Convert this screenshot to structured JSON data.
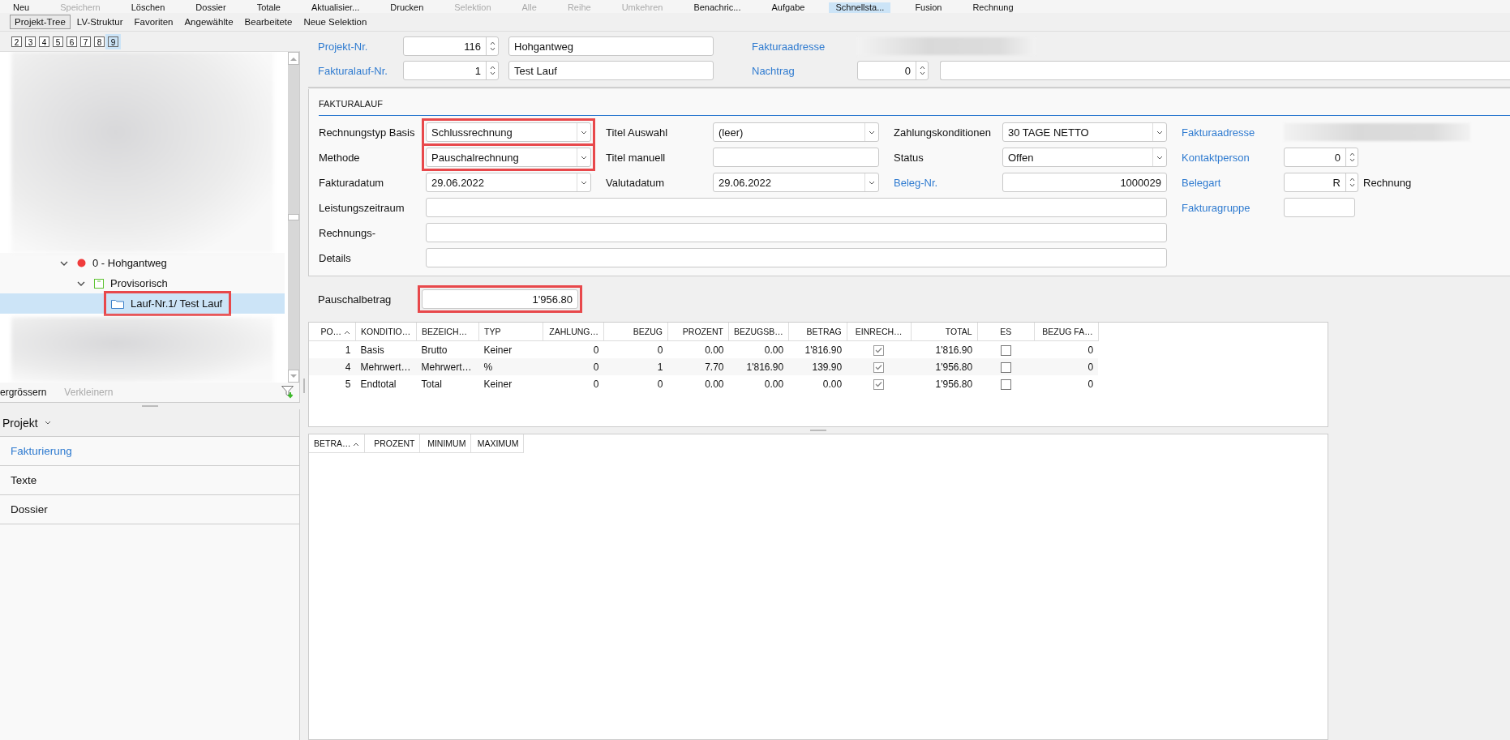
{
  "toolbar": [
    {
      "label": "Neu",
      "disabled": false,
      "selected": false
    },
    {
      "label": "Speichern",
      "disabled": true,
      "selected": false
    },
    {
      "label": "Löschen",
      "disabled": false,
      "selected": false
    },
    {
      "label": "Dossier",
      "disabled": false,
      "selected": false
    },
    {
      "label": "Totale",
      "disabled": false,
      "selected": false
    },
    {
      "label": "Aktualisier...",
      "disabled": false,
      "selected": false
    },
    {
      "label": "Drucken",
      "disabled": false,
      "selected": false
    },
    {
      "label": "Selektion",
      "disabled": true,
      "selected": false
    },
    {
      "label": "Alle",
      "disabled": true,
      "selected": false
    },
    {
      "label": "Reihe",
      "disabled": true,
      "selected": false
    },
    {
      "label": "Umkehren",
      "disabled": true,
      "selected": false
    },
    {
      "label": "Benachric...",
      "disabled": false,
      "selected": false
    },
    {
      "label": "Aufgabe",
      "disabled": false,
      "selected": false
    },
    {
      "label": "Schnellsta...",
      "disabled": false,
      "selected": true
    },
    {
      "label": "Fusion",
      "disabled": false,
      "selected": false
    },
    {
      "label": "Rechnung",
      "disabled": false,
      "selected": false
    }
  ],
  "tabs": [
    {
      "label": "Projekt-Tree",
      "selected": true
    },
    {
      "label": "LV-Struktur",
      "selected": false
    },
    {
      "label": "Favoriten",
      "selected": false
    },
    {
      "label": "Angewählte",
      "selected": false
    },
    {
      "label": "Bearbeitete",
      "selected": false
    },
    {
      "label": "Neue Selektion",
      "selected": false
    }
  ],
  "levels": [
    {
      "label": "2",
      "selected": false
    },
    {
      "label": "3",
      "selected": false
    },
    {
      "label": "4",
      "selected": false
    },
    {
      "label": "5",
      "selected": false
    },
    {
      "label": "6",
      "selected": false
    },
    {
      "label": "7",
      "selected": false
    },
    {
      "label": "8",
      "selected": false
    },
    {
      "label": "9",
      "selected": true
    }
  ],
  "tree": [
    {
      "label": "0 - Hohgantweg",
      "kind": "status",
      "expanded": true,
      "selected": false,
      "highlighted": false,
      "children": [
        {
          "label": "Provisorisch",
          "kind": "draft",
          "expanded": true,
          "selected": false,
          "highlighted": false,
          "children": [
            {
              "label": "Lauf-Nr.1/ Test Lauf",
              "kind": "folder",
              "selected": true,
              "highlighted": true
            }
          ]
        }
      ]
    }
  ],
  "tree_footer": [
    {
      "label": "ergrössern",
      "disabled": false
    },
    {
      "label": "Verkleinern",
      "disabled": true
    }
  ],
  "nav": {
    "header": "Projekt",
    "items": [
      {
        "label": "Fakturierung",
        "selected": true
      },
      {
        "label": "Texte",
        "selected": false
      },
      {
        "label": "Dossier",
        "selected": false
      }
    ]
  },
  "header": {
    "rows": [
      {
        "label": "Projekt-Nr.",
        "link": true,
        "number": "116",
        "text": "Hohgantweg",
        "right": {
          "label": "Fakturaadresse",
          "link": true,
          "kind": "blurred"
        }
      },
      {
        "label": "Fakturalauf-Nr.",
        "link": true,
        "number": "1",
        "text": "Test Lauf",
        "right": {
          "label": "Nachtrag",
          "link": true,
          "kind": "spinner",
          "value": "0"
        }
      }
    ]
  },
  "fakturalauf": {
    "title": "FAKTURALAUF",
    "rows": [
      [
        {
          "label": "Rechnungstyp Basis",
          "link": false,
          "kind": "dropdown",
          "value": "Schlussrechnung",
          "highlighted": true
        },
        {
          "label": "Titel Auswahl",
          "link": false,
          "kind": "dropdown",
          "value": "(leer)",
          "highlighted": false
        },
        {
          "label": "Zahlungskonditionen",
          "link": false,
          "kind": "dropdown",
          "value": "30 TAGE NETTO",
          "highlighted": false
        },
        {
          "label": "Fakturaadresse",
          "link": true,
          "kind": "blurred",
          "highlighted": false
        }
      ],
      [
        {
          "label": "Methode",
          "link": false,
          "kind": "dropdown",
          "value": "Pauschalrechnung",
          "highlighted": true
        },
        {
          "label": "Titel manuell",
          "link": false,
          "kind": "text",
          "highlighted": false
        },
        {
          "label": "Status",
          "link": false,
          "kind": "dropdown",
          "value": "Offen",
          "highlighted": false
        },
        {
          "label": "Kontaktperson",
          "link": true,
          "kind": "spinner",
          "value": "0",
          "highlighted": false
        }
      ],
      [
        {
          "label": "Fakturadatum",
          "link": false,
          "kind": "dropdown",
          "value": "29.06.2022",
          "highlighted": false
        },
        {
          "label": "Valutadatum",
          "link": false,
          "kind": "dropdown",
          "value": "29.06.2022",
          "highlighted": false
        },
        {
          "label": "Beleg-Nr.",
          "link": true,
          "kind": "number",
          "value": "1000029",
          "highlighted": false
        },
        {
          "label": "Belegart",
          "link": true,
          "kind": "spinner",
          "value": "R",
          "suffix": "Rechnung",
          "highlighted": false
        }
      ],
      [
        {
          "label": "Leistungszeitraum",
          "link": false,
          "kind": "wide",
          "highlighted": false
        },
        "",
        "",
        {
          "label": "Fakturagruppe",
          "link": true,
          "kind": "small",
          "highlighted": false
        }
      ],
      [
        {
          "label": "Rechnungs-",
          "link": false,
          "kind": "wide",
          "highlighted": false
        }
      ],
      [
        {
          "label": "Details",
          "link": false,
          "kind": "wide",
          "highlighted": false
        }
      ]
    ]
  },
  "pauschal": {
    "label": "Pauschalbetrag",
    "value": "1'956.80",
    "highlighted": true
  },
  "table": {
    "columns": [
      {
        "label": "PO…",
        "kind": "number",
        "sorted": true
      },
      {
        "label": "KONDITIO…",
        "kind": "text",
        "sorted": false
      },
      {
        "label": "BEZEICH…",
        "kind": "text",
        "sorted": false
      },
      {
        "label": "TYP",
        "kind": "text",
        "sorted": false
      },
      {
        "label": "ZAHLUNG…",
        "kind": "number",
        "sorted": false
      },
      {
        "label": "BEZUG",
        "kind": "number",
        "sorted": false
      },
      {
        "label": "PROZENT",
        "kind": "number",
        "sorted": false
      },
      {
        "label": "BEZUGSB…",
        "kind": "number",
        "sorted": false
      },
      {
        "label": "BETRAG",
        "kind": "number",
        "sorted": false
      },
      {
        "label": "EINRECH…",
        "kind": "check",
        "sorted": false
      },
      {
        "label": "TOTAL",
        "kind": "number",
        "sorted": false
      },
      {
        "label": "ES",
        "kind": "check",
        "sorted": false
      },
      {
        "label": "BEZUG FA…",
        "kind": "number",
        "sorted": false
      }
    ],
    "rows": [
      {
        "cells": [
          "1",
          "Basis",
          "Brutto",
          "Keiner",
          "0",
          "0",
          "0.00",
          "0.00",
          "1'816.90",
          true,
          "1'816.90",
          false,
          "0"
        ]
      },
      {
        "cells": [
          "4",
          "Mehrwert…",
          "Mehrwert…",
          "%",
          "0",
          "1",
          "7.70",
          "1'816.90",
          "139.90",
          true,
          "1'956.80",
          false,
          "0"
        ]
      },
      {
        "cells": [
          "5",
          "Endtotal",
          "Total",
          "Keiner",
          "0",
          "0",
          "0.00",
          "0.00",
          "0.00",
          true,
          "1'956.80",
          false,
          "0"
        ]
      }
    ]
  },
  "table2": {
    "columns": [
      {
        "label": "BETRA…",
        "sorted": true
      },
      {
        "label": "PROZENT",
        "sorted": false
      },
      {
        "label": "MINIMUM",
        "sorted": false
      },
      {
        "label": "MAXIMUM",
        "sorted": false
      }
    ]
  }
}
